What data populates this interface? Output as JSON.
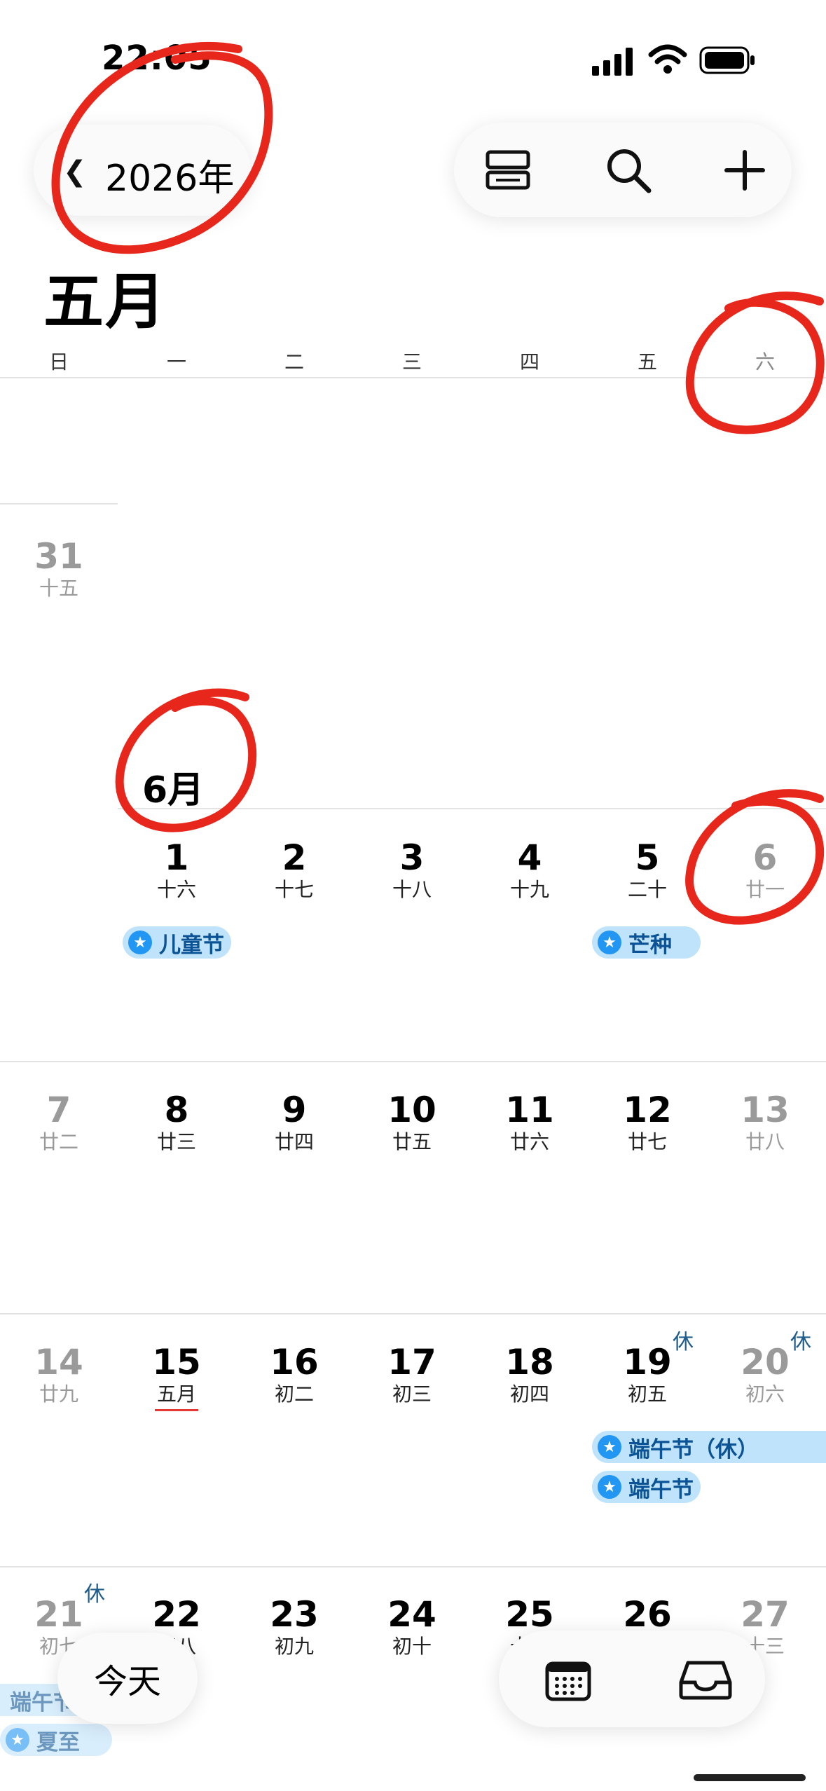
{
  "status_bar": {
    "time": "22:05"
  },
  "header": {
    "year_label": "2026年",
    "month_title": "五月"
  },
  "weekdays": [
    "日",
    "一",
    "二",
    "三",
    "四",
    "五",
    "六"
  ],
  "month_labels": {
    "june": "6月"
  },
  "rows": [
    {
      "days": [
        {
          "num": "31",
          "lunar": "十五",
          "col": 0,
          "grey": true
        }
      ]
    },
    {
      "days": [
        {
          "num": "1",
          "lunar": "十六",
          "col": 1
        },
        {
          "num": "2",
          "lunar": "十七",
          "col": 2
        },
        {
          "num": "3",
          "lunar": "十八",
          "col": 3
        },
        {
          "num": "4",
          "lunar": "十九",
          "col": 4
        },
        {
          "num": "5",
          "lunar": "二十",
          "col": 5
        },
        {
          "num": "6",
          "lunar": "廿一",
          "col": 6,
          "grey": true
        }
      ]
    },
    {
      "days": [
        {
          "num": "7",
          "lunar": "廿二",
          "col": 0,
          "grey": true
        },
        {
          "num": "8",
          "lunar": "廿三",
          "col": 1
        },
        {
          "num": "9",
          "lunar": "廿四",
          "col": 2
        },
        {
          "num": "10",
          "lunar": "廿五",
          "col": 3
        },
        {
          "num": "11",
          "lunar": "廿六",
          "col": 4
        },
        {
          "num": "12",
          "lunar": "廿七",
          "col": 5
        },
        {
          "num": "13",
          "lunar": "廿八",
          "col": 6,
          "grey": true
        }
      ]
    },
    {
      "days": [
        {
          "num": "14",
          "lunar": "廿九",
          "col": 0,
          "grey": true
        },
        {
          "num": "15",
          "lunar": "五月",
          "col": 1,
          "today": true
        },
        {
          "num": "16",
          "lunar": "初二",
          "col": 2
        },
        {
          "num": "17",
          "lunar": "初三",
          "col": 3
        },
        {
          "num": "18",
          "lunar": "初四",
          "col": 4
        },
        {
          "num": "19",
          "lunar": "初五",
          "col": 5,
          "rest": "休"
        },
        {
          "num": "20",
          "lunar": "初六",
          "col": 6,
          "grey": true,
          "rest": "休"
        }
      ]
    },
    {
      "days": [
        {
          "num": "21",
          "lunar": "初七",
          "col": 0,
          "grey": true,
          "rest": "休"
        },
        {
          "num": "22",
          "lunar": "初八",
          "col": 1
        },
        {
          "num": "23",
          "lunar": "初九",
          "col": 2
        },
        {
          "num": "24",
          "lunar": "初十",
          "col": 3
        },
        {
          "num": "25",
          "lunar": "十一",
          "col": 4
        },
        {
          "num": "26",
          "lunar": "十二",
          "col": 5
        },
        {
          "num": "27",
          "lunar": "十三",
          "col": 6,
          "grey": true
        }
      ]
    }
  ],
  "events": {
    "children_day": "儿童节",
    "grain_in_ear": "芒种",
    "dragon_boat_rest": "端午节（休）",
    "dragon_boat": "端午节",
    "dragon_boat_cont": "端午节",
    "summer_solstice": "夏至"
  },
  "buttons": {
    "today": "今天"
  },
  "icons": [
    "back-chevron-icon",
    "view-toggle-icon",
    "search-icon",
    "add-icon",
    "calendar-icon",
    "inbox-icon",
    "event-star-icon"
  ],
  "colors": {
    "event_bg": "#bfe3fb",
    "event_text": "#0b5394",
    "star": "#2196f3",
    "annotation": "#e8271c",
    "today_underline": "#e53935"
  }
}
